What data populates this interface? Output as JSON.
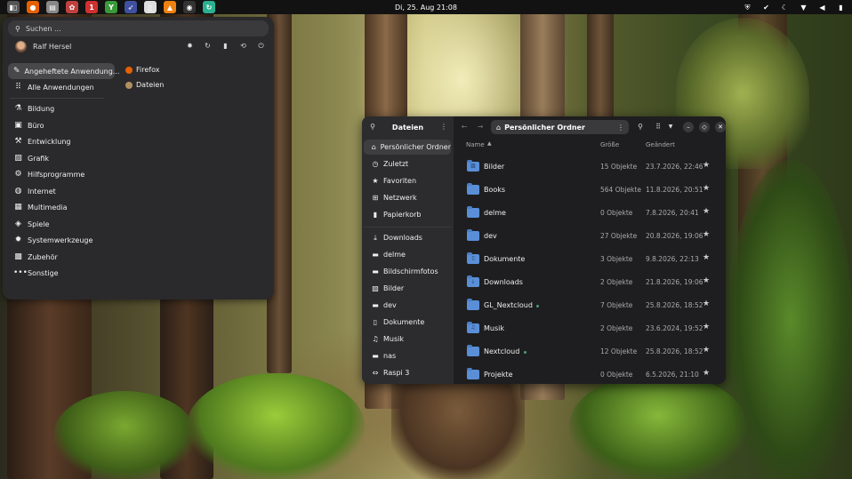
{
  "topbar": {
    "clock": "Di, 25. Aug  21:08",
    "apps": [
      {
        "name": "workspaces-icon",
        "glyph": "▮▯",
        "color": "#555"
      },
      {
        "name": "firefox-icon",
        "glyph": "●",
        "color": "#e66000"
      },
      {
        "name": "files-icon",
        "glyph": "▤",
        "color": "#888"
      },
      {
        "name": "settings-app-icon",
        "glyph": "✿",
        "color": "#c04040"
      },
      {
        "name": "bookmark-app-icon",
        "glyph": "1",
        "color": "#d03030"
      },
      {
        "name": "vpn-app-icon",
        "glyph": "Y",
        "color": "#3a9a3a"
      },
      {
        "name": "rocket-app-icon",
        "glyph": "➶",
        "color": "#4050a0"
      },
      {
        "name": "document-app-icon",
        "glyph": "▯",
        "color": "#ddd"
      },
      {
        "name": "vlc-app-icon",
        "glyph": "▲",
        "color": "#f08010"
      },
      {
        "name": "disk-app-icon",
        "glyph": "◉",
        "color": "#333"
      },
      {
        "name": "sync-app-icon",
        "glyph": "↻",
        "color": "#2ab090"
      }
    ],
    "status_icons": [
      "shield-icon",
      "check-circle-icon",
      "moon-icon",
      "wifi-icon",
      "volume-icon",
      "battery-icon"
    ]
  },
  "launcher": {
    "search_placeholder": "Suchen ...",
    "user_name": "Ralf Hersel",
    "user_actions": [
      "settings-icon",
      "restart-icon",
      "lock-icon",
      "switch-user-icon",
      "power-icon"
    ],
    "categories": [
      {
        "label": "Angeheftete Anwendung...",
        "icon": "pin-icon",
        "glyph": "✎",
        "selected": true
      },
      {
        "label": "Alle Anwendungen",
        "icon": "grid-icon",
        "glyph": "⠿",
        "selected": false
      },
      {
        "label": "Bildung",
        "icon": "flask-icon",
        "glyph": "⚗",
        "selected": false
      },
      {
        "label": "Büro",
        "icon": "briefcase-icon",
        "glyph": "▣",
        "selected": false
      },
      {
        "label": "Entwicklung",
        "icon": "toolbox-icon",
        "glyph": "⚒",
        "selected": false
      },
      {
        "label": "Grafik",
        "icon": "image-icon",
        "glyph": "▨",
        "selected": false
      },
      {
        "label": "Hilfsprogramme",
        "icon": "wrench-icon",
        "glyph": "⚙",
        "selected": false
      },
      {
        "label": "Internet",
        "icon": "globe-icon",
        "glyph": "◍",
        "selected": false
      },
      {
        "label": "Multimedia",
        "icon": "media-icon",
        "glyph": "▦",
        "selected": false
      },
      {
        "label": "Spiele",
        "icon": "gamepad-icon",
        "glyph": "◈",
        "selected": false
      },
      {
        "label": "Systemwerkzeuge",
        "icon": "gear-icon",
        "glyph": "✹",
        "selected": false
      },
      {
        "label": "Zubehör",
        "icon": "accessories-icon",
        "glyph": "▩",
        "selected": false
      },
      {
        "label": "Sonstige",
        "icon": "more-icon",
        "glyph": "•••",
        "selected": false
      }
    ],
    "pinned_apps": [
      {
        "label": "Firefox",
        "icon": "firefox-icon",
        "color": "#e66000"
      },
      {
        "label": "Dateien",
        "icon": "files-icon",
        "color": "#b09060"
      }
    ]
  },
  "files": {
    "sidebar_title": "Dateien",
    "path": "Persönlicher Ordner",
    "columns": {
      "name": "Name",
      "size": "Größe",
      "modified": "Geändert"
    },
    "places": [
      {
        "label": "Persönlicher Ordner",
        "icon": "home-icon",
        "glyph": "⌂",
        "selected": true
      },
      {
        "label": "Zuletzt",
        "icon": "clock-icon",
        "glyph": "◷",
        "selected": false
      },
      {
        "label": "Favoriten",
        "icon": "star-icon",
        "glyph": "★",
        "selected": false
      },
      {
        "label": "Netzwerk",
        "icon": "network-icon",
        "glyph": "⊞",
        "selected": false
      },
      {
        "label": "Papierkorb",
        "icon": "trash-icon",
        "glyph": "▮",
        "selected": false
      }
    ],
    "bookmarks": [
      {
        "label": "Downloads",
        "icon": "download-icon",
        "glyph": "⤓"
      },
      {
        "label": "delme",
        "icon": "folder-icon",
        "glyph": "▬"
      },
      {
        "label": "Bildschirmfotos",
        "icon": "folder-icon",
        "glyph": "▬"
      },
      {
        "label": "Bilder",
        "icon": "picture-icon",
        "glyph": "▨"
      },
      {
        "label": "dev",
        "icon": "folder-icon",
        "glyph": "▬"
      },
      {
        "label": "Dokumente",
        "icon": "document-icon",
        "glyph": "▯"
      },
      {
        "label": "Musik",
        "icon": "music-icon",
        "glyph": "♫"
      },
      {
        "label": "nas",
        "icon": "folder-icon",
        "glyph": "▬"
      },
      {
        "label": "Raspi 3",
        "icon": "remote-icon",
        "glyph": "⇔"
      }
    ],
    "rows": [
      {
        "name": "Bilder",
        "size": "15 Objekte",
        "modified": "23.7.2026, 22:46",
        "glyph": "▨",
        "sync": false
      },
      {
        "name": "Books",
        "size": "564 Objekte",
        "modified": "11.8.2026, 20:51",
        "glyph": "",
        "sync": false
      },
      {
        "name": "delme",
        "size": "0 Objekte",
        "modified": "7.8.2026, 20:41",
        "glyph": "",
        "sync": false
      },
      {
        "name": "dev",
        "size": "27 Objekte",
        "modified": "20.8.2026, 19:06",
        "glyph": "",
        "sync": false
      },
      {
        "name": "Dokumente",
        "size": "3 Objekte",
        "modified": "9.8.2026, 22:13",
        "glyph": "▯",
        "sync": false
      },
      {
        "name": "Downloads",
        "size": "2 Objekte",
        "modified": "21.8.2026, 19:06",
        "glyph": "⤓",
        "sync": false
      },
      {
        "name": "GL_Nextcloud",
        "size": "7 Objekte",
        "modified": "25.8.2026, 18:52",
        "glyph": "",
        "sync": true
      },
      {
        "name": "Musik",
        "size": "2 Objekte",
        "modified": "23.6.2024, 19:52",
        "glyph": "♫",
        "sync": false
      },
      {
        "name": "Nextcloud",
        "size": "12 Objekte",
        "modified": "25.8.2026, 18:52",
        "glyph": "",
        "sync": true
      },
      {
        "name": "Projekte",
        "size": "0 Objekte",
        "modified": "6.5.2026, 21:10",
        "glyph": "",
        "sync": false
      }
    ]
  },
  "colors": {
    "accent_folder": "#5a8fd8",
    "panel_bg": "#2a2a2c",
    "window_bg": "#1e1e20",
    "sync_dot": "#4c9e70"
  }
}
